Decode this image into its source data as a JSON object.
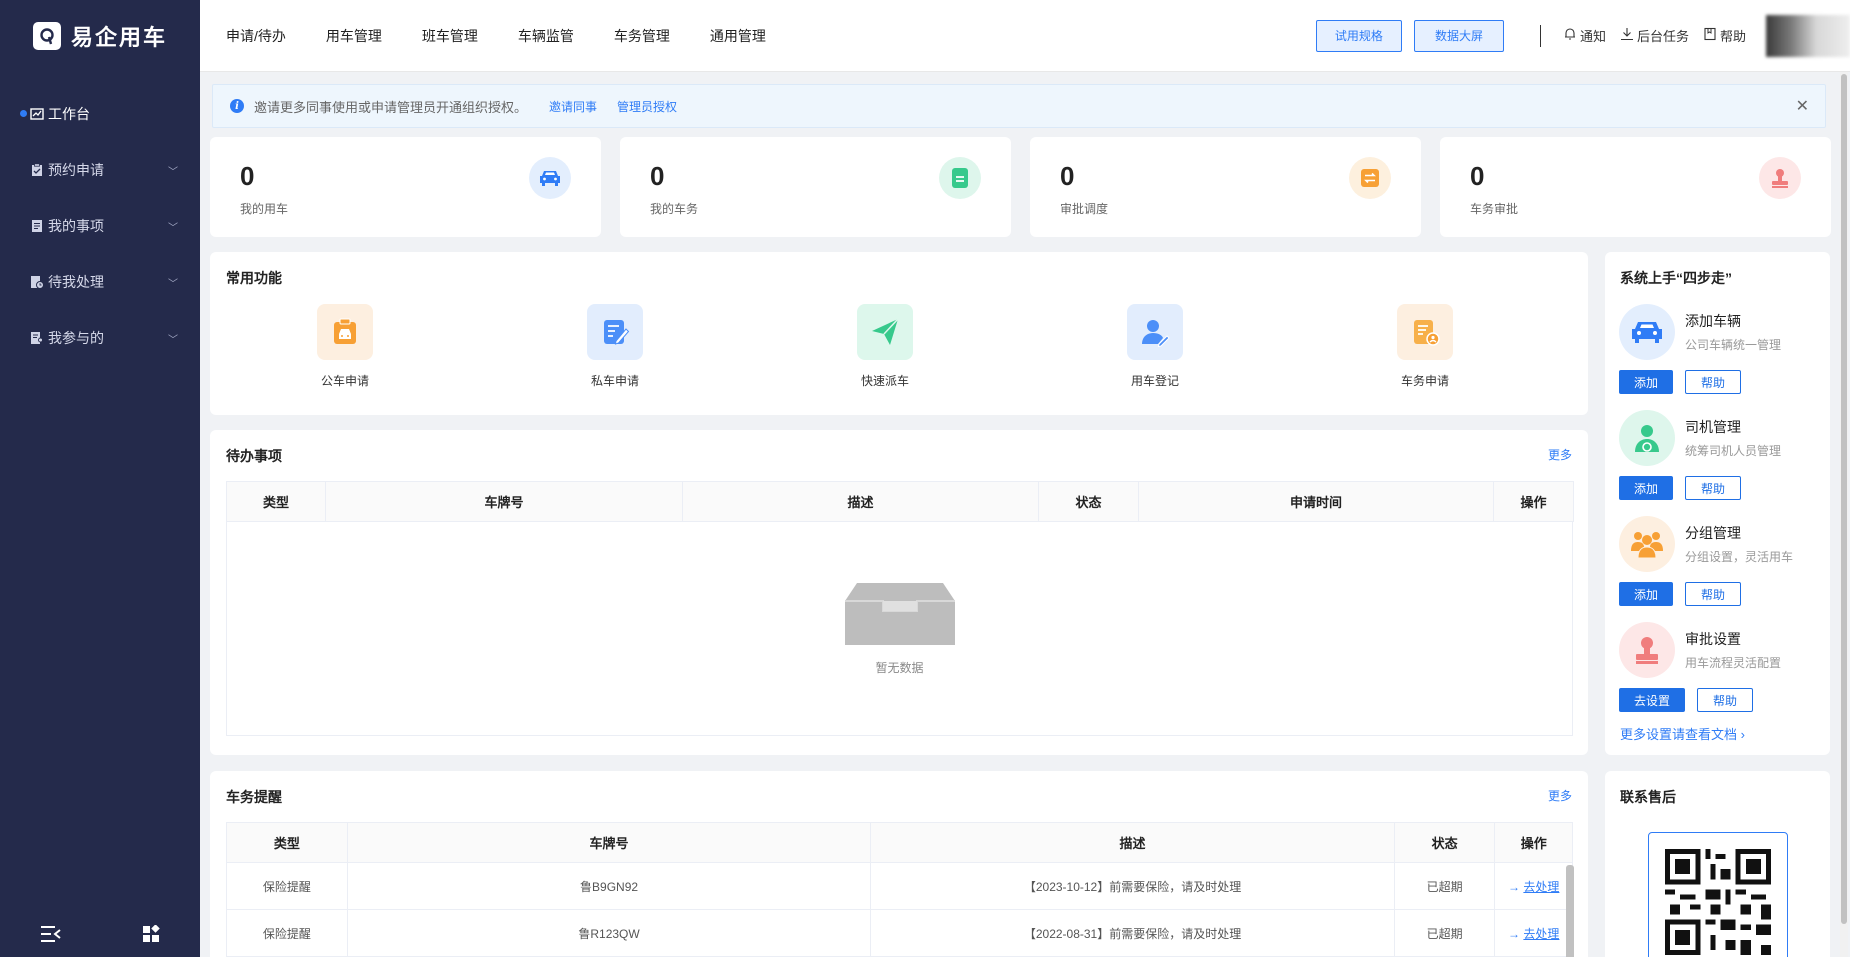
{
  "app": {
    "name": "易企用车"
  },
  "sidebar": {
    "items": [
      {
        "label": "工作台",
        "active": true
      },
      {
        "label": "预约申请"
      },
      {
        "label": "我的事项"
      },
      {
        "label": "待我处理"
      },
      {
        "label": "我参与的"
      }
    ]
  },
  "header": {
    "menu": [
      "申请/待办",
      "用车管理",
      "班车管理",
      "车辆监管",
      "车务管理",
      "通用管理"
    ],
    "buttons": {
      "trial": "试用规格",
      "screen": "数据大屏"
    },
    "links": {
      "notify": "通知",
      "tasks": "后台任务",
      "help": "帮助"
    }
  },
  "notice": {
    "text": "邀请更多同事使用或申请管理员开通组织授权。",
    "invite": "邀请同事",
    "authorize": "管理员授权"
  },
  "stats": [
    {
      "value": "0",
      "label": "我的用车",
      "color": "#2f7cf6"
    },
    {
      "value": "0",
      "label": "我的车务",
      "color": "#37c98c"
    },
    {
      "value": "0",
      "label": "审批调度",
      "color": "#f7a035"
    },
    {
      "value": "0",
      "label": "车务审批",
      "color": "#f07d7d"
    }
  ],
  "common": {
    "title": "常用功能",
    "items": [
      {
        "label": "公车申请",
        "icon": "car-form-icon"
      },
      {
        "label": "私车申请",
        "icon": "edit-doc-icon"
      },
      {
        "label": "快速派车",
        "icon": "paper-plane-icon"
      },
      {
        "label": "用车登记",
        "icon": "user-edit-icon"
      },
      {
        "label": "车务申请",
        "icon": "doc-user-icon"
      }
    ]
  },
  "todo": {
    "title": "待办事项",
    "more": "更多",
    "columns": [
      "类型",
      "车牌号",
      "描述",
      "状态",
      "申请时间",
      "操作"
    ],
    "empty": "暂无数据"
  },
  "reminder": {
    "title": "车务提醒",
    "more": "更多",
    "columns": [
      "类型",
      "车牌号",
      "描述",
      "状态",
      "操作"
    ],
    "rows": [
      {
        "type": "保险提醒",
        "plate": "鲁B9GN92",
        "desc": "【2023-10-12】前需要保险，请及时处理",
        "status": "已超期",
        "op": "去处理"
      },
      {
        "type": "保险提醒",
        "plate": "鲁R123QW",
        "desc": "【2022-08-31】前需要保险，请及时处理",
        "status": "已超期",
        "op": "去处理"
      }
    ]
  },
  "steps": {
    "title": "系统上手“四步走”",
    "items": [
      {
        "title": "添加车辆",
        "sub": "公司车辆统一管理",
        "primary": "添加",
        "secondary": "帮助"
      },
      {
        "title": "司机管理",
        "sub": "统筹司机人员管理",
        "primary": "添加",
        "secondary": "帮助"
      },
      {
        "title": "分组管理",
        "sub": "分组设置，灵活用车",
        "primary": "添加",
        "secondary": "帮助"
      },
      {
        "title": "审批设置",
        "sub": "用车流程灵活配置",
        "primary": "去设置",
        "secondary": "帮助"
      }
    ],
    "doc_link": "更多设置请查看文档"
  },
  "support": {
    "title": "联系售后"
  }
}
